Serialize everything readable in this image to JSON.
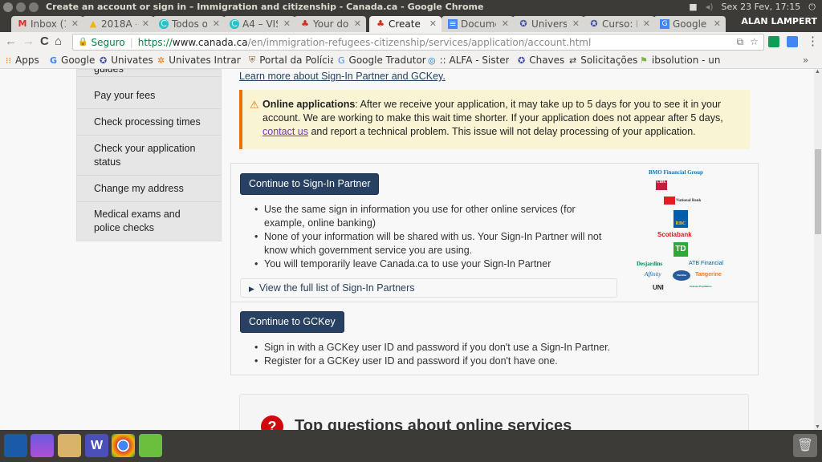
{
  "window": {
    "title": "Create an account or sign in – Immigration and citizenship - Canada.ca - Google Chrome",
    "tray": {
      "datetime": "Sex 23 Fev, 17:15"
    },
    "profile": "ALAN LAMPERT"
  },
  "tabs": [
    {
      "label": "Inbox (1",
      "icon": "gmail-icon",
      "active": false
    },
    {
      "label": "2018A - ",
      "icon": "drive-icon",
      "active": false
    },
    {
      "label": "Todos o",
      "icon": "canva-icon",
      "active": false
    },
    {
      "label": "A4 – VIS",
      "icon": "canva-icon",
      "active": false
    },
    {
      "label": "Your do",
      "icon": "maple-leaf-icon",
      "active": false
    },
    {
      "label": "Create a",
      "icon": "maple-leaf-icon",
      "active": true
    },
    {
      "label": "Docume",
      "icon": "docs-icon",
      "active": false
    },
    {
      "label": "Univers",
      "icon": "univates-icon",
      "active": false
    },
    {
      "label": "Curso: E",
      "icon": "univates-icon",
      "active": false
    },
    {
      "label": "Google T",
      "icon": "translate-icon",
      "active": false
    }
  ],
  "address_bar": {
    "security_label": "Seguro",
    "scheme": "https://",
    "host": "www.canada.ca",
    "path": "/en/immigration-refugees-citizenship/services/application/account.html"
  },
  "bookmarks": [
    {
      "label": "Apps",
      "icon": "apps-grid-icon"
    },
    {
      "label": "Google",
      "icon": "google-icon"
    },
    {
      "label": "Univates",
      "icon": "univates-icon"
    },
    {
      "label": "Univates Intrane",
      "icon": "intranet-icon"
    },
    {
      "label": "Portal da Polícia",
      "icon": "police-icon"
    },
    {
      "label": "Google Tradutor",
      "icon": "translate-icon"
    },
    {
      "label": ":: ALFA - Sistema",
      "icon": "alfa-icon"
    },
    {
      "label": "Chaves",
      "icon": "univates-icon"
    },
    {
      "label": "Solicitações",
      "icon": "swap-icon"
    },
    {
      "label": "ibsolution - univ",
      "icon": "flag-icon"
    }
  ],
  "sidenav": {
    "items": [
      {
        "label": "guides"
      },
      {
        "label": "Pay your fees"
      },
      {
        "label": "Check processing times"
      },
      {
        "label": "Check your application status"
      },
      {
        "label": "Change my address"
      },
      {
        "label": "Medical exams and police checks"
      }
    ]
  },
  "main": {
    "learn_more_link": "Learn more about Sign-In Partner and GCKey.",
    "alert": {
      "bold": "Online applications",
      "text1": ": After we receive your application, it may take up to 5 days for you to see it in your account. We are working to make this wait time shorter. If your application does not appear after 5 days, ",
      "link": "contact us",
      "text2": " and report a technical problem. This issue will not delay processing of your application."
    },
    "partner": {
      "button": "Continue to Sign-In Partner",
      "bullets": [
        "Use the same sign in information you use for other online services (for example, online banking)",
        "None of your information will be shared with us. Your Sign-In Partner will not know which government service you are using.",
        "You will temporarily leave Canada.ca to use your Sign-In Partner"
      ],
      "details_label": "View the full list of Sign-In Partners",
      "logos": [
        "BMO Financial Group",
        "CIBC",
        "National Bank",
        "RBC",
        "Scotiabank",
        "TD",
        "Desjardins",
        "ATB Financial",
        "Affinity",
        "Meridian",
        "Tangerine",
        "UNI",
        "Caisses Populaires"
      ]
    },
    "gckey": {
      "button": "Continue to GCKey",
      "bullets": [
        "Sign in with a GCKey user ID and password if you don't use a Sign-In Partner.",
        "Register for a GCKey user ID and password if you don't have one."
      ]
    },
    "top_questions": {
      "title": "Top questions about online services",
      "icon_glyph": "?"
    }
  },
  "launcher": [
    "dash-icon",
    "workspace-icon",
    "files-icon",
    "writer-icon",
    "chrome-icon",
    "editor-icon"
  ],
  "colors": {
    "accent": "#284162",
    "alert_border": "#ee7100",
    "alert_bg": "#f9f4d4",
    "visited_link": "#7834bc",
    "question_red": "#d3080c"
  }
}
